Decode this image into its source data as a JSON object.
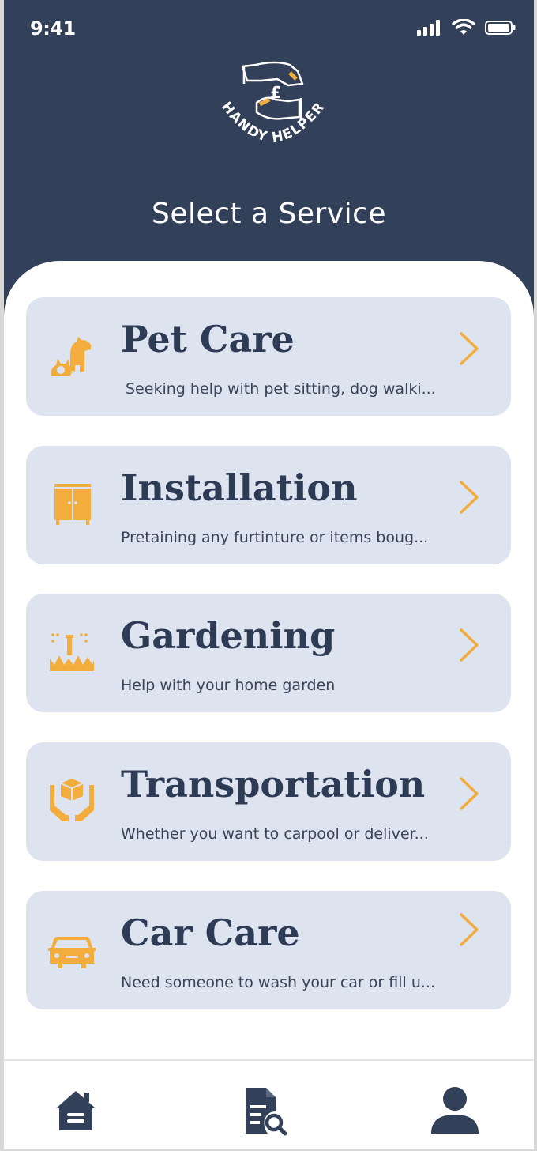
{
  "status": {
    "time": "9:41"
  },
  "brand": {
    "logo_text": "HANDY HELPER",
    "currency_symbol": "£"
  },
  "page": {
    "title": "Select a Service"
  },
  "services": [
    {
      "title": "Pet Care",
      "description": "Seeking help with pet sitting, dog walki...",
      "icon": "pet-icon"
    },
    {
      "title": "Installation",
      "description": "Pretaining any furtinture or items boug...",
      "icon": "cupboard-icon"
    },
    {
      "title": "Gardening",
      "description": "Help with your home garden",
      "icon": "sprinkler-icon"
    },
    {
      "title": "Transportation",
      "description": "Whether you want to carpool or deliver...",
      "icon": "package-hands-icon"
    },
    {
      "title": "Car Care",
      "description": "Need someone to wash your car or fill u...",
      "icon": "car-icon"
    }
  ],
  "nav": [
    {
      "icon": "home-icon"
    },
    {
      "icon": "document-search-icon"
    },
    {
      "icon": "profile-icon"
    }
  ],
  "colors": {
    "header": "#334059",
    "accent": "#f2ad3c",
    "card": "#dde3ef",
    "text_dark": "#2e3b55"
  }
}
